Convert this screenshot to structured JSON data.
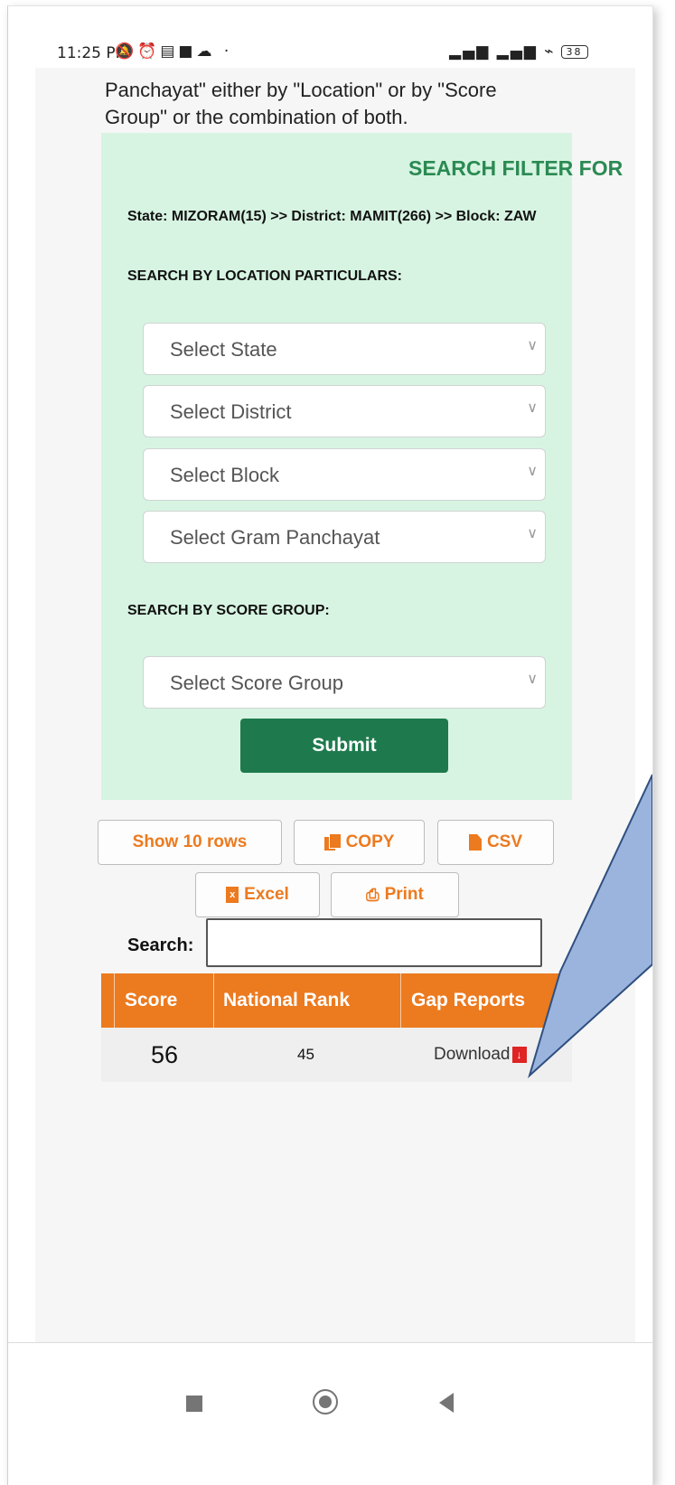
{
  "status_bar": {
    "time": "11:25 PM",
    "battery": "38"
  },
  "intro_text_line1": "Panchayat\" either by \"Location\" or by \"Score",
  "intro_text_line2": "Group\" or the combination of both.",
  "filter_panel": {
    "title": "SEARCH FILTER FOR",
    "breadcrumb": "State: MIZORAM(15) >> District: MAMIT(266) >> Block: ZAW",
    "location_heading": "SEARCH BY LOCATION PARTICULARS:",
    "state_select": "Select State",
    "district_select": "Select District",
    "block_select": "Select Block",
    "gp_select": "Select Gram Panchayat",
    "score_heading": "SEARCH BY SCORE GROUP:",
    "score_select": "Select Score Group",
    "submit": "Submit",
    "accent_color": "#2a8a52",
    "panel_color": "#d7f4e2"
  },
  "table_buttons": {
    "show_rows": "Show 10 rows",
    "copy": "COPY",
    "csv": "CSV",
    "excel": "Excel",
    "print": "Print",
    "accent_color": "#ec7a1f"
  },
  "search": {
    "label": "Search:",
    "value": ""
  },
  "table": {
    "headers": [
      "Score",
      "National Rank",
      "Gap Reports"
    ],
    "rows": [
      {
        "score": "56",
        "rank": "45",
        "gap": "Download"
      }
    ]
  },
  "icons": {
    "copy": "copy-icon",
    "csv": "file-icon",
    "excel": "excel-icon",
    "print": "printer-icon",
    "pdf": "pdf-icon"
  }
}
